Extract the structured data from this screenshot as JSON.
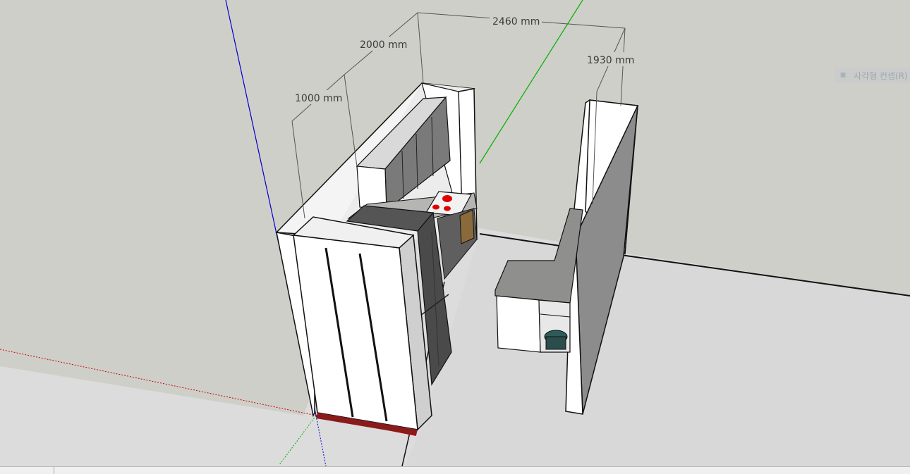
{
  "dimensions": {
    "overall_width": "2460 mm",
    "left_depth": "2000 mm",
    "left_section": "1000 mm",
    "right_depth": "1930 mm"
  },
  "tooltip": {
    "icon": "selection-icon",
    "text": "사각형 컨셉(R)"
  },
  "axes": {
    "red": "#cc0000",
    "green": "#00b000",
    "blue": "#0000cc"
  },
  "colors": {
    "sky": "#cfcfc9",
    "ground": "#dcdcdc",
    "wall": "#ffffff",
    "cabinet_dark": "#6e6e6e",
    "countertop": "#8a8a88",
    "cooktop_burner": "#e00000",
    "wood_door": "#8a6a3a"
  }
}
